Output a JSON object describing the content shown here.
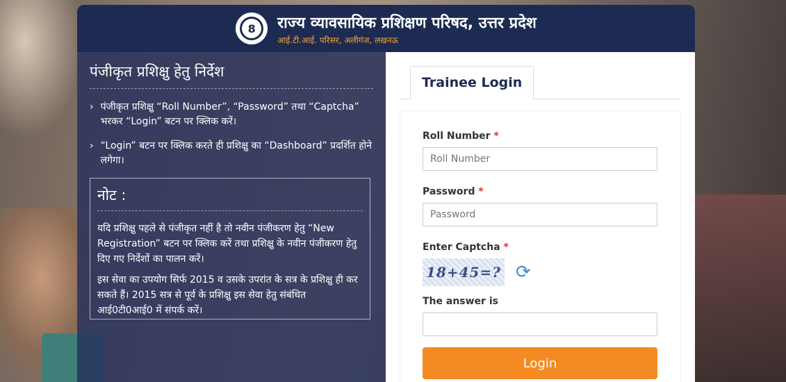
{
  "header": {
    "title": "राज्य व्यावसायिक प्रशिक्षण परिषद, उत्तर प्रदेश",
    "subtitle": "आई.टी.आई. परिसर, अलीगंज, लखनऊ",
    "emblem_glyph": "8"
  },
  "instructions": {
    "title": "पंजीकृत प्रशिक्षु हेतु निर्देश",
    "items": [
      {
        "chevron": "›",
        "text": "पंजीकृत प्रशिक्षु “Roll Number”, “Password” तथा “Captcha” भरकर “Login” बटन पर क्लिक करें।"
      },
      {
        "chevron": "›",
        "text": "“Login” बटन पर क्लिक करते ही प्रशिक्षु का “Dashboard” प्रदर्शित होने लगेगा।"
      }
    ]
  },
  "note": {
    "title": "नोट :",
    "paragraphs": [
      "यदि प्रशिक्षु पहले से पंजीकृत नहीं है तो नवीन पंजीकरण हेतु “New Registration” बटन पर क्लिक करें तथा प्रशिक्षु के नवीन पंजीकरण हेतु दिए गए निर्देशों का पालन करें।",
      "इस सेवा का उपयोग सिर्फ 2015 व उसके उपरांत के सत्र के प्रशिक्षु ही कर सकते हैं। 2015 सत्र से पूर्व के प्रशिक्षु इस सेवा हेतु संबंधित आई0टी0आई0 में संपर्क करें।"
    ]
  },
  "login": {
    "tab_label": "Trainee Login",
    "roll_label": "Roll Number",
    "roll_placeholder": "Roll Number",
    "password_label": "Password",
    "password_placeholder": "Password",
    "captcha_label": "Enter Captcha",
    "captcha_text": "18+45=?",
    "refresh_glyph": "⟳",
    "answer_label": "The answer is",
    "answer_value": "",
    "required_mark": "*",
    "button_label": "Login"
  },
  "colors": {
    "header_bg": "#1d2b52",
    "subtitle": "#f2a33a",
    "button": "#f38a22",
    "required": "#d9302f"
  },
  "icons": [
    "emblem-icon",
    "chevron-right-icon",
    "refresh-icon"
  ]
}
